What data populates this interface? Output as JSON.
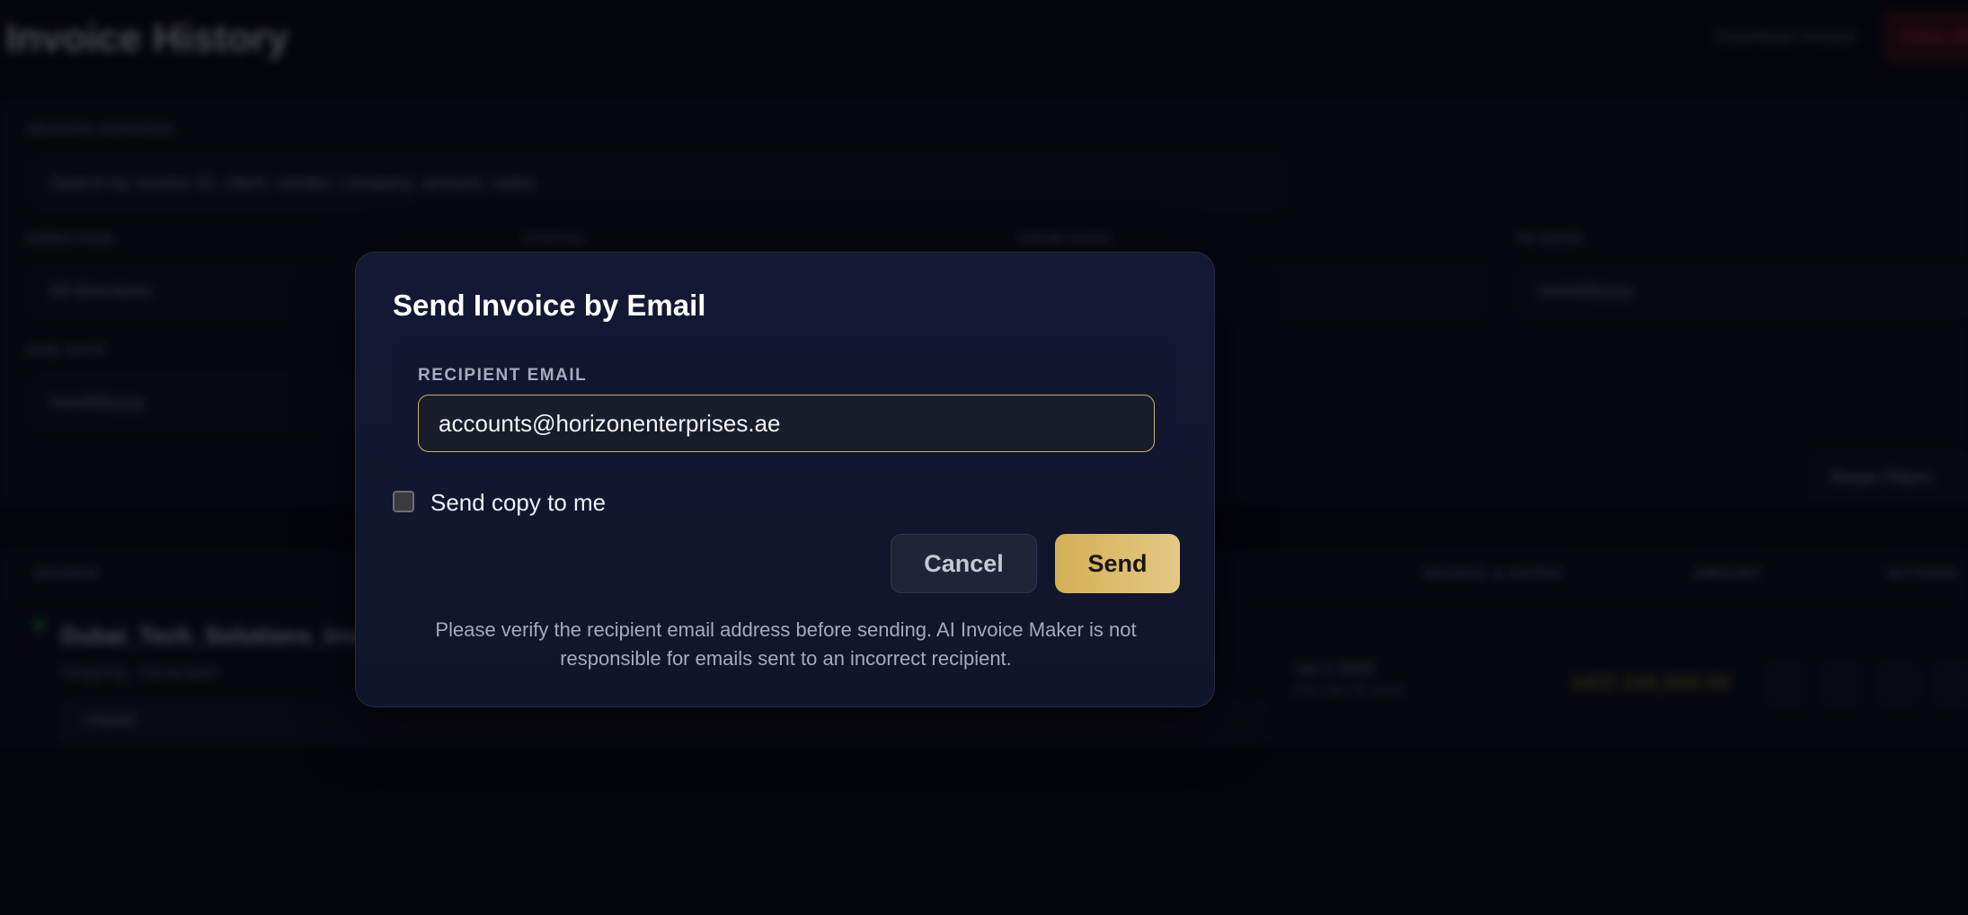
{
  "background": {
    "page_title": "Invoice History",
    "header_link": "Download Invoice",
    "header_button": "Clear All",
    "filters": {
      "search_label": "SEARCH INVOICES",
      "search_placeholder": "Search by invoice ID, client, vendor, company, amount, notes",
      "direction_label": "DIRECTION",
      "direction_value": "All directions",
      "status_label": "STATUS",
      "from_label": "FROM DATE",
      "to_label": "TO DATE",
      "to_value": "mm/dd/yyyy",
      "due_label": "DUE DATE",
      "due_value": "mm/dd/yyyy",
      "reset_button": "Reset Filters"
    },
    "table": {
      "columns": [
        "INVOICE",
        "INVOICE & DATES",
        "AMOUNT",
        "ACTIONS"
      ],
      "rows": [
        {
          "name": "Dubai_Tech_Solutions_Invoice",
          "subtitle": "Outgoing · Generated",
          "status": "Unpaid",
          "dates": "Jan 1 2025",
          "dates_sub": "Due Jan 31 2025",
          "amount": "AED 245,000.00"
        }
      ]
    }
  },
  "modal": {
    "title": "Send Invoice by Email",
    "recipient_label": "RECIPIENT EMAIL",
    "recipient_value": "accounts@horizonenterprises.ae",
    "copy_label": "Send copy to me",
    "copy_checked": false,
    "cancel_label": "Cancel",
    "send_label": "Send",
    "disclaimer": "Please verify the recipient email address before sending. AI Invoice Maker is not responsible for emails sent to an incorrect recipient."
  },
  "colors": {
    "accent_gold": "#d4b054",
    "modal_bg": "#131935",
    "page_bg": "#06070d"
  }
}
